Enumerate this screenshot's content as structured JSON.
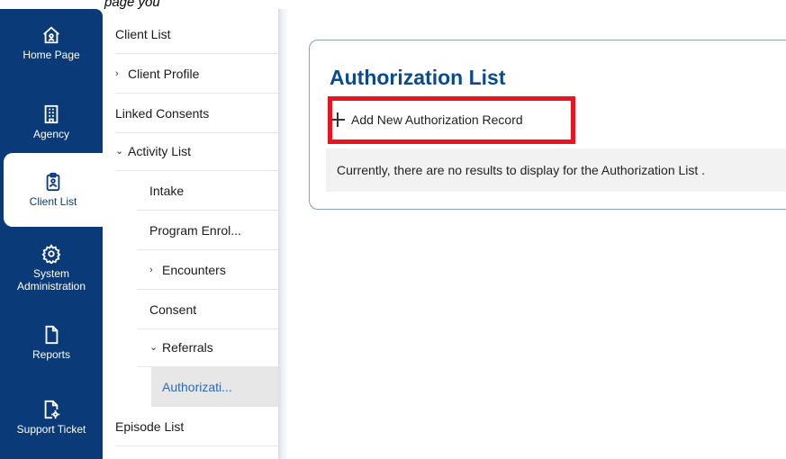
{
  "caption": "page you",
  "rail": {
    "items": [
      {
        "label": "Home Page",
        "icon": "home-icon"
      },
      {
        "label": "Agency",
        "icon": "building-icon"
      },
      {
        "label": "Client List",
        "icon": "clipboard-icon",
        "active": true
      },
      {
        "label": "System Administration",
        "icon": "gear-icon"
      },
      {
        "label": "Reports",
        "icon": "document-icon"
      },
      {
        "label": "Support Ticket",
        "icon": "ticket-gear-icon"
      }
    ],
    "colors": {
      "background": "#0b3a78",
      "active_text": "#0b3a78"
    }
  },
  "subnav": {
    "items": [
      {
        "label": "Client List"
      },
      {
        "label": "Client Profile",
        "chevron": "›"
      },
      {
        "label": "Linked Consents"
      },
      {
        "label": "Activity List",
        "chevron": "⌄"
      },
      {
        "label": "Intake"
      },
      {
        "label": "Program Enrol..."
      },
      {
        "label": "Encounters",
        "chevron": "›"
      },
      {
        "label": "Consent"
      },
      {
        "label": "Referrals",
        "chevron": "⌄"
      },
      {
        "label": "Authorizati...",
        "selected": true
      },
      {
        "label": "Episode List"
      }
    ]
  },
  "main": {
    "title": "Authorization List",
    "add_button_label": "Add New Authorization Record",
    "empty_message": "Currently, there are no results to display for the Authorization List .",
    "colors": {
      "title": "#0b4a8f",
      "highlight_border": "#e8141f",
      "selected_text": "#2d6ab3"
    }
  }
}
